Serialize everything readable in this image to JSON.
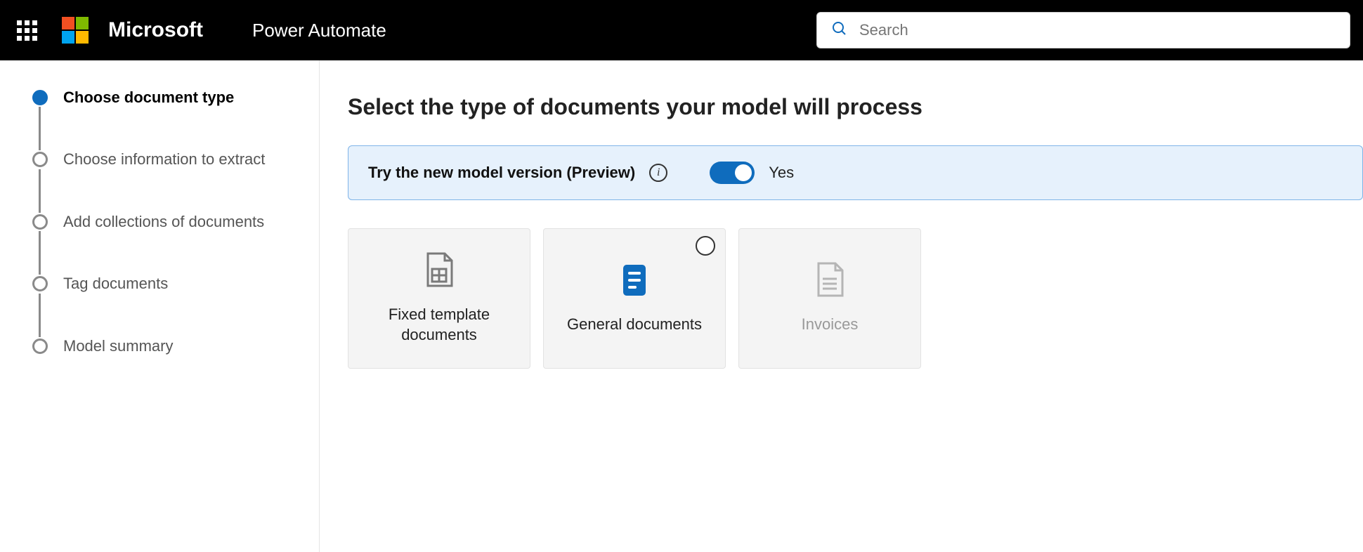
{
  "header": {
    "brand": "Microsoft",
    "product": "Power Automate",
    "search_placeholder": "Search"
  },
  "sidebar": {
    "steps": [
      {
        "label": "Choose document type",
        "active": true
      },
      {
        "label": "Choose information to extract",
        "active": false
      },
      {
        "label": "Add collections of documents",
        "active": false
      },
      {
        "label": "Tag documents",
        "active": false
      },
      {
        "label": "Model summary",
        "active": false
      }
    ]
  },
  "main": {
    "title": "Select the type of documents your model will process",
    "preview_banner": {
      "text": "Try the new model version (Preview)",
      "toggle_on": true,
      "toggle_label": "Yes"
    },
    "cards": [
      {
        "label": "Fixed template documents",
        "selected": false,
        "icon": "template-doc-icon",
        "show_radio": false,
        "disabled": false
      },
      {
        "label": "General documents",
        "selected": false,
        "icon": "general-doc-icon",
        "show_radio": true,
        "disabled": false
      },
      {
        "label": "Invoices",
        "selected": false,
        "icon": "invoice-doc-icon",
        "show_radio": false,
        "disabled": true
      }
    ]
  }
}
